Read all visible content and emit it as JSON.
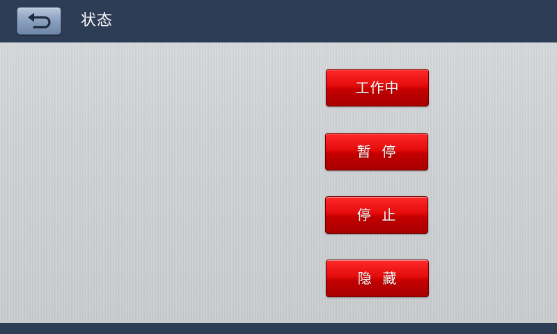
{
  "header": {
    "title": "状态",
    "back_icon": "back-arrow-icon"
  },
  "actions": [
    {
      "label": "工作中"
    },
    {
      "label": "暂  停"
    },
    {
      "label": "停  止"
    },
    {
      "label": "隐  藏"
    }
  ],
  "colors": {
    "header_bg": "#2e3d56",
    "button_red": "#d40000",
    "back_button": "#8ea3c1",
    "background": "#cfd2d4"
  }
}
